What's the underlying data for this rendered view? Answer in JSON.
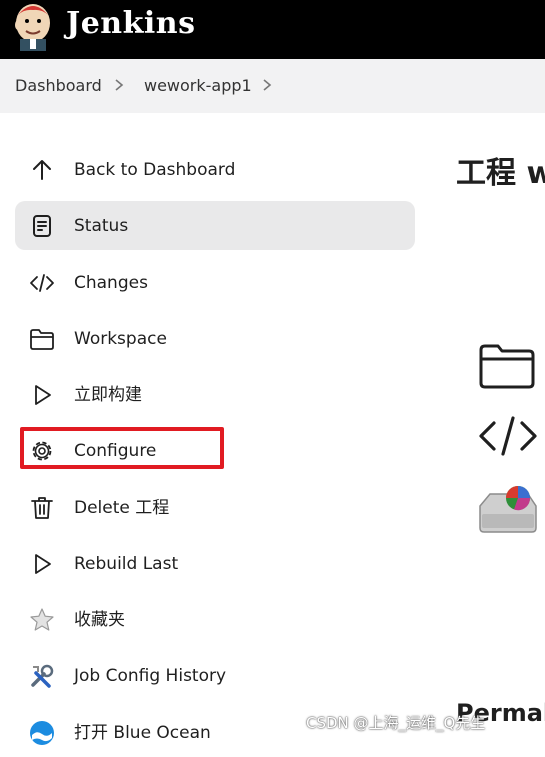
{
  "header": {
    "brand": "Jenkins"
  },
  "breadcrumb": {
    "items": [
      "Dashboard",
      "wework-app1"
    ]
  },
  "sidebar": {
    "items": [
      {
        "label": "Back to Dashboard",
        "icon": "arrow-up-icon"
      },
      {
        "label": "Status",
        "icon": "document-icon",
        "active": true
      },
      {
        "label": "Changes",
        "icon": "code-icon"
      },
      {
        "label": "Workspace",
        "icon": "folder-icon"
      },
      {
        "label": "立即构建",
        "icon": "play-icon"
      },
      {
        "label": "Configure",
        "icon": "gear-icon",
        "highlighted": true
      },
      {
        "label": "Delete 工程",
        "icon": "trash-icon"
      },
      {
        "label": "Rebuild Last",
        "icon": "play-icon"
      },
      {
        "label": "收藏夹",
        "icon": "star-icon"
      },
      {
        "label": "Job Config History",
        "icon": "tools-icon"
      },
      {
        "label": "打开 Blue Ocean",
        "icon": "blue-ocean-icon"
      }
    ]
  },
  "main": {
    "title": "工程 w",
    "section_title": "Permal"
  },
  "watermark": "CSDN @上海_运维_Q先生",
  "colors": {
    "topbar": "#000000",
    "highlight": "#e11b22",
    "active_bg": "#e9e9ea"
  }
}
